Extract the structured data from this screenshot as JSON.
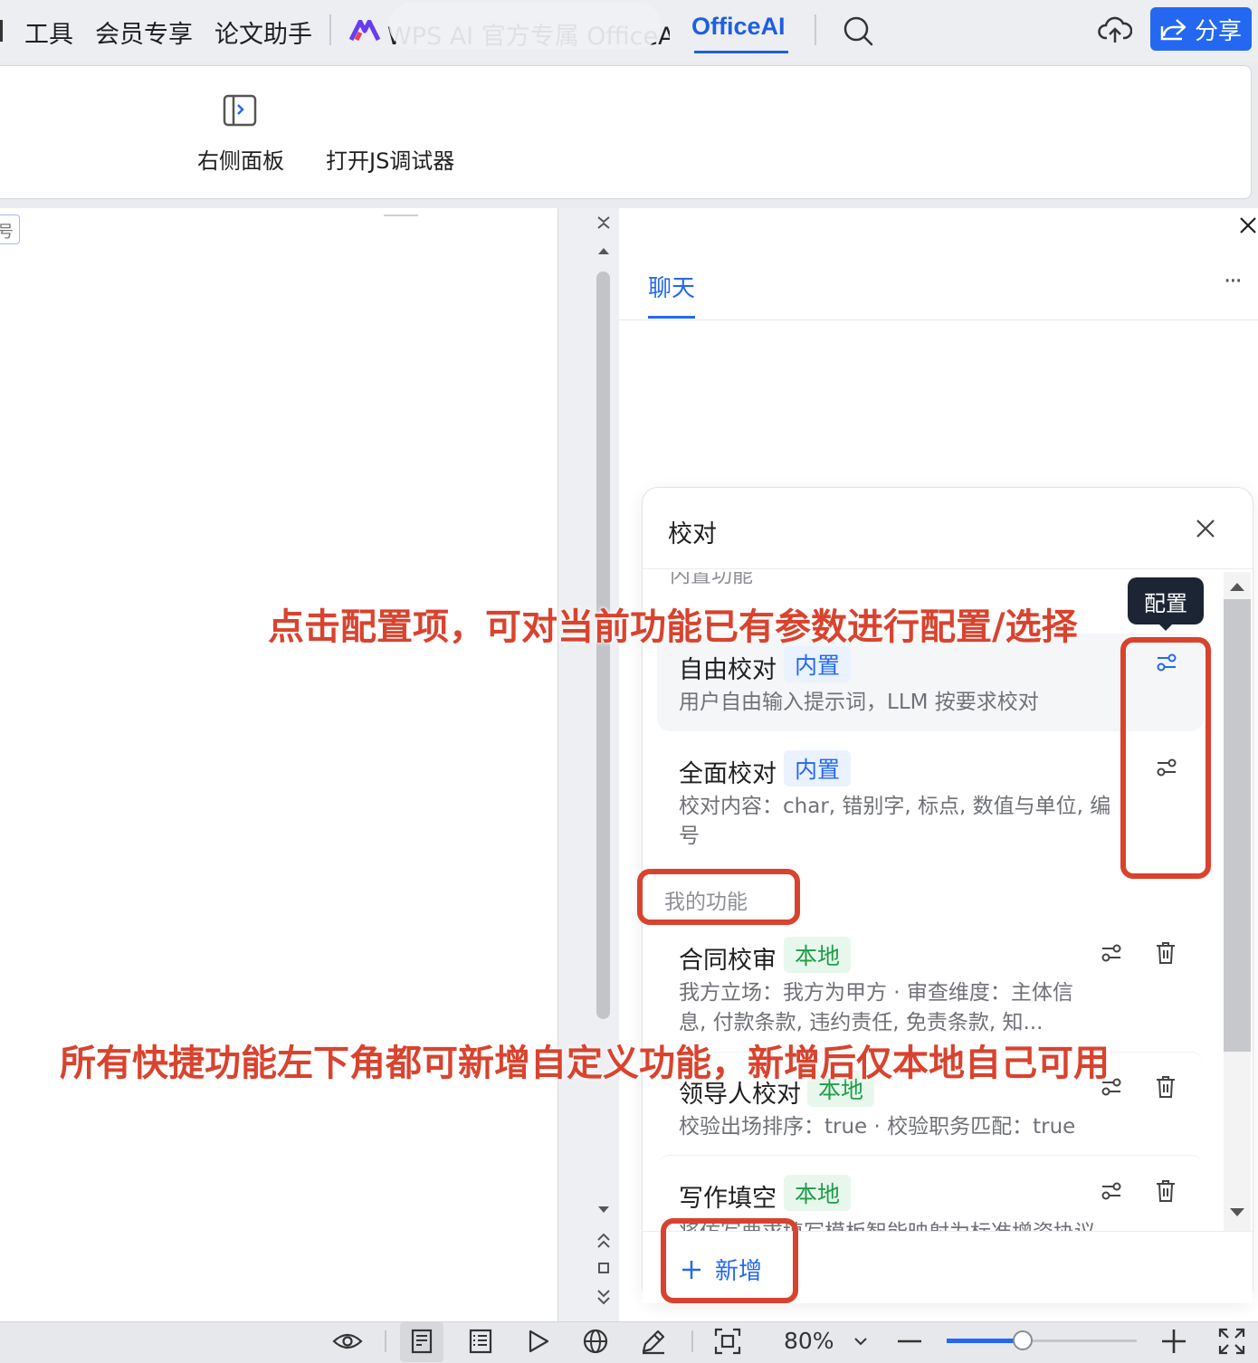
{
  "menu": {
    "items": [
      "工具",
      "会员专享",
      "论文助手"
    ],
    "blurred_tab_tail": "WPS AI   官方专属 OfficeAI",
    "active_tab": "OfficeAI",
    "share_label": "分享"
  },
  "ribbon": {
    "right_panel_label": "右侧面板",
    "js_debugger_label": "打开JS调试器"
  },
  "document": {
    "tab_char": "号"
  },
  "chat": {
    "tab_label": "聊天",
    "more_label": "···"
  },
  "popup": {
    "title": "校对",
    "section_builtin_partial": "内置功能",
    "tooltip": "配置",
    "builtin_items": [
      {
        "title": "自由校对",
        "badge": "内置",
        "desc": "用户自由输入提示词，LLM 按要求校对"
      },
      {
        "title": "全面校对",
        "badge": "内置",
        "desc": "校对内容：char, 错别字, 标点, 数值与单位, 编号"
      }
    ],
    "section_mine": "我的功能",
    "my_items": [
      {
        "title": "合同校审",
        "badge": "本地",
        "desc": "我方立场：我方为甲方 · 审查维度：主体信息, 付款条款, 违约责任, 免责条款, 知..."
      },
      {
        "title": "领导人校对",
        "badge": "本地",
        "desc": "校验出场排序：true · 校验职务匹配：true"
      },
      {
        "title": "写作填空",
        "badge": "本地",
        "desc": "将仿写要求填写模板智能映射为标准增资协议"
      }
    ],
    "add_label": "新增"
  },
  "annotations": {
    "top": "点击配置项，可对当前功能已有参数进行配置/选择",
    "bottom": "所有快捷功能左下角都可新增自定义功能，新增后仅本地自己可用"
  },
  "statusbar": {
    "zoom": "80%",
    "zoom_fraction": 0.4
  },
  "colors": {
    "accent": "#2468f2",
    "annotation": "#d9432e"
  }
}
